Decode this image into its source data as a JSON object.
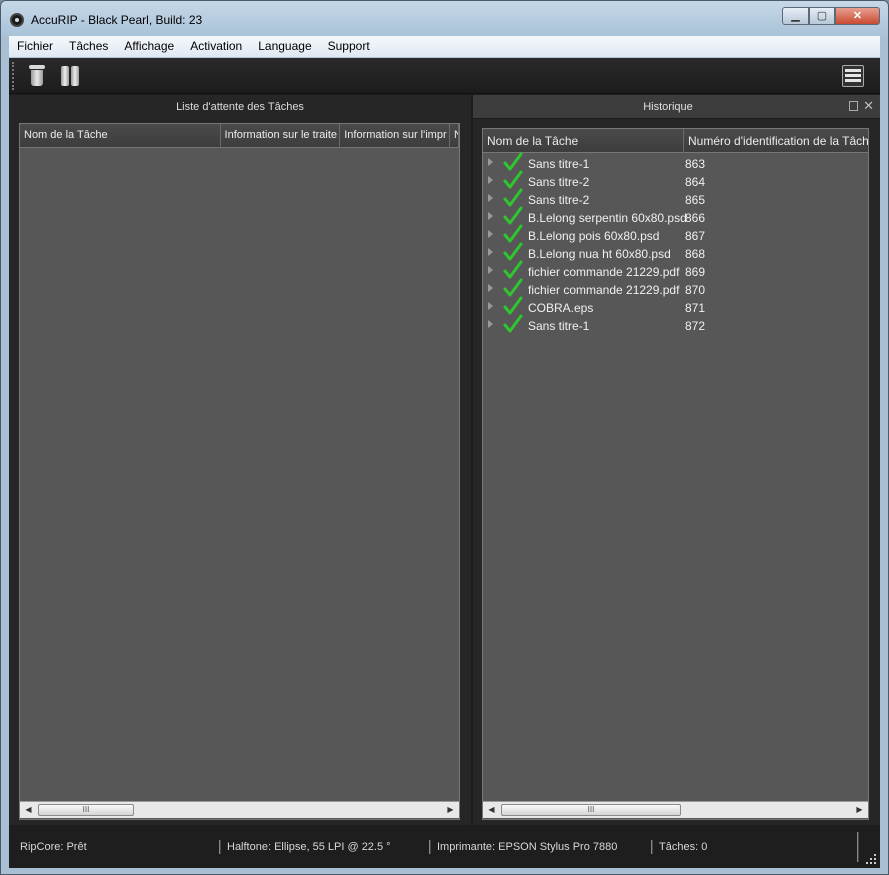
{
  "window": {
    "title": "AccuRIP - Black Pearl, Build: 23"
  },
  "menu": [
    "Fichier",
    "Tâches",
    "Affichage",
    "Activation",
    "Language",
    "Support"
  ],
  "toolbar": {
    "icons": [
      "trash-icon",
      "pause-icon",
      "menu-icon"
    ]
  },
  "queue": {
    "title": "Liste d'attente des Tâches",
    "columns": [
      "Nom de la Tâche",
      "Information sur le traite",
      "Information sur l'impr",
      "N"
    ],
    "rows": []
  },
  "history": {
    "title": "Historique",
    "columns": [
      "Nom de la Tâche",
      "Numéro d'identification de la Tâch"
    ],
    "rows": [
      {
        "name": "Sans titre-1",
        "id": "863"
      },
      {
        "name": "Sans titre-2",
        "id": "864"
      },
      {
        "name": "Sans titre-2",
        "id": "865"
      },
      {
        "name": "B.Lelong serpentin 60x80.psd",
        "id": "866"
      },
      {
        "name": "B.Lelong pois 60x80.psd",
        "id": "867"
      },
      {
        "name": "B.Lelong nua ht 60x80.psd",
        "id": "868"
      },
      {
        "name": "fichier commande 21229.pdf",
        "id": "869"
      },
      {
        "name": "fichier commande 21229.pdf",
        "id": "870"
      },
      {
        "name": "COBRA.eps",
        "id": "871"
      },
      {
        "name": "Sans titre-1",
        "id": "872"
      }
    ]
  },
  "scrollbar": {
    "thumb_label": "III"
  },
  "status": {
    "ripcore_label": "RipCore:",
    "ripcore_value": "Prêt",
    "halftone_label": "Halftone:",
    "halftone_value": "Ellipse, 55 LPI @ 22.5 °",
    "printer_label": "Imprimante:",
    "printer_value": "EPSON Stylus Pro 7880",
    "tasks_label": "Tâches:",
    "tasks_value": "0"
  },
  "colors": {
    "check": "#2fc52f",
    "panel": "#575757",
    "background": "#1e1e1e"
  }
}
